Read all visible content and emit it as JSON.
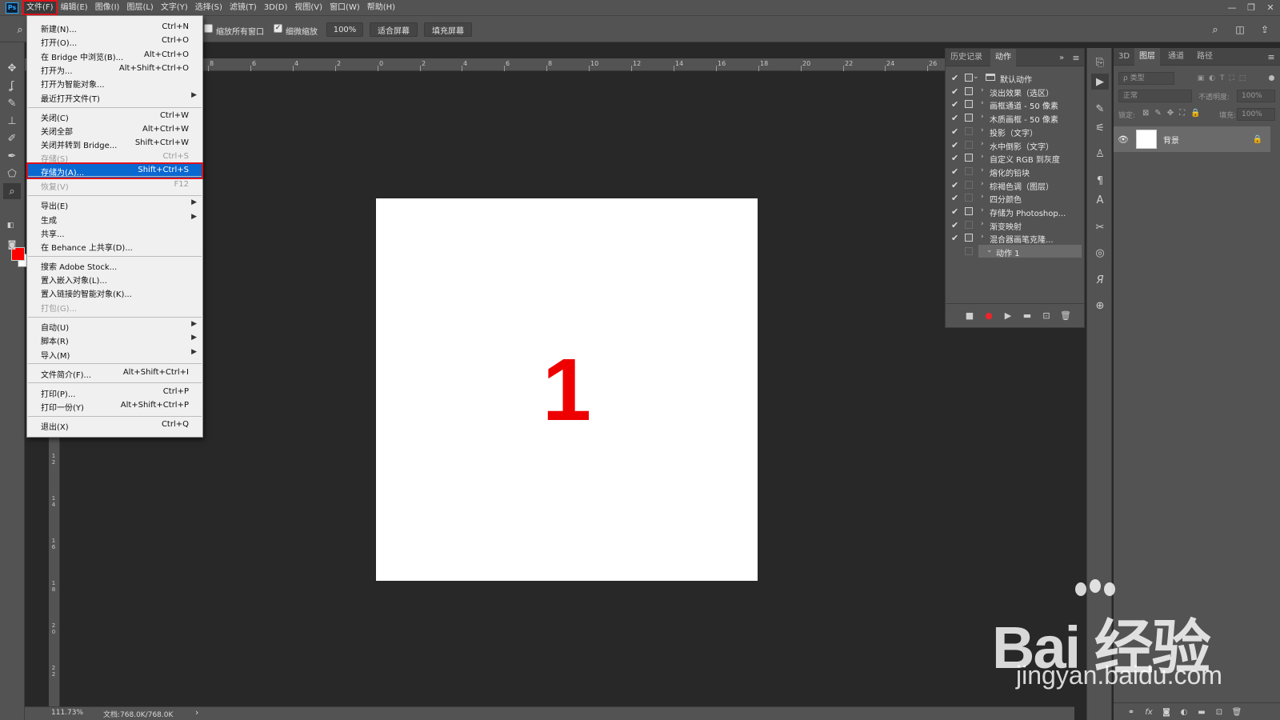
{
  "app": {
    "logo": "Ps"
  },
  "menubar": {
    "items": [
      "文件(F)",
      "编辑(E)",
      "图像(I)",
      "图层(L)",
      "文字(Y)",
      "选择(S)",
      "滤镜(T)",
      "3D(D)",
      "视图(V)",
      "窗口(W)",
      "帮助(H)"
    ],
    "active_index": 0
  },
  "window_controls": {
    "minimize": "—",
    "restore": "❐",
    "close": "✕"
  },
  "options_bar": {
    "resize_windows_label": "缩放所有窗口",
    "resize_windows_checked": false,
    "scrubby_zoom_label": "细微缩放",
    "scrubby_zoom_checked": true,
    "zoom_value": "100%",
    "fit_screen": "适合屏幕",
    "fill_screen": "填充屏幕"
  },
  "rulers": {
    "top_labels": [
      "8",
      "6",
      "4",
      "2",
      "0",
      "2",
      "4",
      "6",
      "8",
      "10",
      "12",
      "14",
      "16",
      "18",
      "20",
      "22",
      "24",
      "26"
    ],
    "left_labels": [
      "1\n2",
      "1\n4",
      "1\n6",
      "1\n8",
      "2\n0",
      "2\n2"
    ]
  },
  "canvas": {
    "content": "1",
    "content_color": "#ee0000",
    "background": "#ffffff"
  },
  "statusbar": {
    "zoom": "111.73%",
    "doc_info": "文档:768.0K/768.0K",
    "arrow": "›"
  },
  "file_menu": {
    "items": [
      {
        "label": "新建(N)...",
        "shortcut": "Ctrl+N"
      },
      {
        "label": "打开(O)...",
        "shortcut": "Ctrl+O"
      },
      {
        "label": "在 Bridge 中浏览(B)...",
        "shortcut": "Alt+Ctrl+O"
      },
      {
        "label": "打开为...",
        "shortcut": "Alt+Shift+Ctrl+O"
      },
      {
        "label": "打开为智能对象...",
        "shortcut": ""
      },
      {
        "label": "最近打开文件(T)",
        "shortcut": "",
        "submenu": true
      },
      {
        "label": "关闭(C)",
        "shortcut": "Ctrl+W"
      },
      {
        "label": "关闭全部",
        "shortcut": "Alt+Ctrl+W"
      },
      {
        "label": "关闭并转到 Bridge...",
        "shortcut": "Shift+Ctrl+W"
      },
      {
        "label": "存储(S)",
        "shortcut": "Ctrl+S",
        "disabled": true
      },
      {
        "label": "存储为(A)...",
        "shortcut": "Shift+Ctrl+S",
        "highlighted": true
      },
      {
        "label": "恢复(V)",
        "shortcut": "F12",
        "disabled": true
      },
      {
        "label": "导出(E)",
        "shortcut": "",
        "submenu": true
      },
      {
        "label": "生成",
        "shortcut": "",
        "submenu": true
      },
      {
        "label": "共享...",
        "shortcut": ""
      },
      {
        "label": "在 Behance 上共享(D)...",
        "shortcut": ""
      },
      {
        "label": "搜索 Adobe Stock...",
        "shortcut": ""
      },
      {
        "label": "置入嵌入对象(L)...",
        "shortcut": ""
      },
      {
        "label": "置入链接的智能对象(K)...",
        "shortcut": ""
      },
      {
        "label": "打包(G)...",
        "shortcut": "",
        "disabled": true
      },
      {
        "label": "自动(U)",
        "shortcut": "",
        "submenu": true
      },
      {
        "label": "脚本(R)",
        "shortcut": "",
        "submenu": true
      },
      {
        "label": "导入(M)",
        "shortcut": "",
        "submenu": true
      },
      {
        "label": "文件简介(F)...",
        "shortcut": "Alt+Shift+Ctrl+I"
      },
      {
        "label": "打印(P)...",
        "shortcut": "Ctrl+P"
      },
      {
        "label": "打印一份(Y)",
        "shortcut": "Alt+Shift+Ctrl+P"
      },
      {
        "label": "退出(X)",
        "shortcut": "Ctrl+Q"
      }
    ]
  },
  "actions_panel": {
    "tabs": [
      "历史记录",
      "动作"
    ],
    "active_tab": 1,
    "set_name": "默认动作",
    "actions": [
      {
        "name": "淡出效果（选区）",
        "dialog": true
      },
      {
        "name": "画框通道 - 50 像素",
        "dialog": true
      },
      {
        "name": "木质画框 - 50 像素",
        "dialog": true
      },
      {
        "name": "投影（文字）",
        "dialog": false
      },
      {
        "name": "水中倒影（文字）",
        "dialog": false
      },
      {
        "name": "自定义 RGB 到灰度",
        "dialog": true
      },
      {
        "name": "熔化的铅块",
        "dialog": false
      },
      {
        "name": "棕褐色调（图层）",
        "dialog": false
      },
      {
        "name": "四分颜色",
        "dialog": false
      },
      {
        "name": "存储为 Photoshop...",
        "dialog": true
      },
      {
        "name": "渐变映射",
        "dialog": false
      },
      {
        "name": "混合器画笔克隆...",
        "dialog": true
      }
    ],
    "selected_action": "动作 1"
  },
  "layers_panel": {
    "tabs": [
      "3D",
      "图层",
      "通道",
      "路径"
    ],
    "active_tab": 1,
    "filter_placeholder": "ρ 类型",
    "blend_mode": "正常",
    "opacity_label": "不透明度:",
    "opacity_value": "100%",
    "lock_label": "锁定:",
    "fill_label": "填充:",
    "fill_value": "100%",
    "layer_name": "背景"
  },
  "watermark": {
    "brand": "Bai  经验",
    "url": "jingyan.baidu.com"
  }
}
